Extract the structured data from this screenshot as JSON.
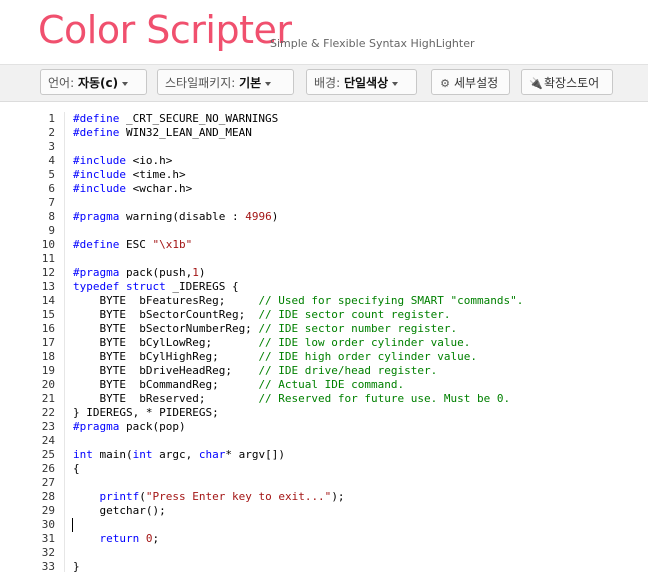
{
  "header": {
    "logo": "Color Scripter",
    "tagline": "Simple & Flexible Syntax HighLighter"
  },
  "toolbar": {
    "language": {
      "label": "언어:",
      "value": "자동(c)"
    },
    "style": {
      "label": "스타일패키지:",
      "value": "기본"
    },
    "background": {
      "label": "배경:",
      "value": "단일색상"
    },
    "settings_label": "세부설정",
    "store_label": "확장스토어",
    "settings_icon": "gear-icon",
    "store_icon": "plug-icon"
  },
  "colors": {
    "brand": "#f0506e",
    "preprocessor": "#0000ff",
    "keyword": "#0000ff",
    "string": "#a31515",
    "comment": "#008000"
  },
  "code": {
    "lines": [
      "1",
      "2",
      "3",
      "4",
      "5",
      "6",
      "7",
      "8",
      "9",
      "10",
      "11",
      "12",
      "13",
      "14",
      "15",
      "16",
      "17",
      "18",
      "19",
      "20",
      "21",
      "22",
      "23",
      "24",
      "25",
      "26",
      "27",
      "28",
      "29",
      "30",
      "31",
      "32",
      "33"
    ],
    "tokens": {
      "l1a": "#define",
      "l1b": " _CRT_SECURE_NO_WARNINGS",
      "l2a": "#define",
      "l2b": " WIN32_LEAN_AND_MEAN",
      "l4a": "#include",
      "l4b": " <io.h>",
      "l5a": "#include",
      "l5b": " <time.h>",
      "l6a": "#include",
      "l6b": " <wchar.h>",
      "l8a": "#pragma",
      "l8b": " warning(disable : ",
      "l8c": "4996",
      "l8d": ")",
      "l10a": "#define",
      "l10b": " ESC ",
      "l10c": "\"\\x1b\"",
      "l12a": "#pragma",
      "l12b": " pack(push,",
      "l12c": "1",
      "l12d": ")",
      "l13a": "typedef",
      "l13b": " struct",
      "l13c": " _IDEREGS {",
      "l14a": "    BYTE  bFeaturesReg;     ",
      "l14b": "// Used for specifying SMART \"commands\".",
      "l15a": "    BYTE  bSectorCountReg;  ",
      "l15b": "// IDE sector count register.",
      "l16a": "    BYTE  bSectorNumberReg; ",
      "l16b": "// IDE sector number register.",
      "l17a": "    BYTE  bCylLowReg;       ",
      "l17b": "// IDE low order cylinder value.",
      "l18a": "    BYTE  bCylHighReg;      ",
      "l18b": "// IDE high order cylinder value.",
      "l19a": "    BYTE  bDriveHeadReg;    ",
      "l19b": "// IDE drive/head register.",
      "l20a": "    BYTE  bCommandReg;      ",
      "l20b": "// Actual IDE command.",
      "l21a": "    BYTE  bReserved;        ",
      "l21b": "// Reserved for future use. Must be 0.",
      "l22a": "} IDEREGS, * PIDEREGS;",
      "l23a": "#pragma",
      "l23b": " pack(pop)",
      "l25a": "int",
      "l25b": " main(",
      "l25c": "int",
      "l25d": " argc, ",
      "l25e": "char",
      "l25f": "* argv[])",
      "l26a": "{",
      "l28a": "    ",
      "l28b": "printf",
      "l28c": "(",
      "l28d": "\"Press Enter key to exit...\"",
      "l28e": ");",
      "l29a": "    getchar();",
      "l31a": "    ",
      "l31b": "return",
      "l31c": " ",
      "l31d": "0",
      "l31e": ";",
      "l33a": "}"
    }
  }
}
